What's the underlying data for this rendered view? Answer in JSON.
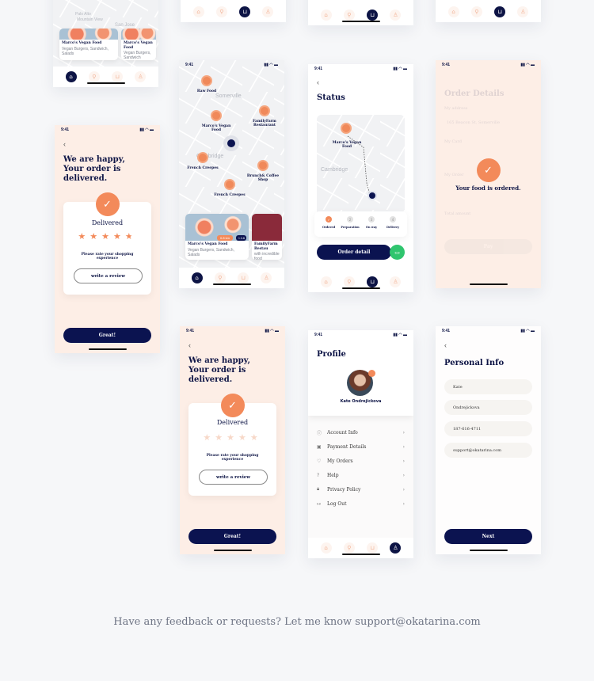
{
  "status_time": "9:41",
  "nav_icons": [
    "home-icon",
    "map-pin-icon",
    "cart-icon",
    "user-icon"
  ],
  "colors": {
    "navy": "#0b1350",
    "accent": "#f38a5a",
    "peach": "#fdeee6",
    "green": "#2fc56e"
  },
  "map_preview": {
    "places": [
      "Palo Alto",
      "Mountain View",
      "San Jose"
    ],
    "cards": [
      {
        "name": "Marco's Vegan Food",
        "sub": "Vegan Burgers, Sandwich, Salads"
      },
      {
        "name": "Marco's Vegan Food",
        "sub": "Vegan Burgers, Sandwich"
      }
    ]
  },
  "map_screen": {
    "areas": [
      "Somerville",
      "Cambridge"
    ],
    "pins": [
      "Raw Food",
      "Marco's Vegan Food",
      "FamilyFarm Restaurant",
      "French Creepes",
      "Brunch& Coffee Shop",
      "French Creepes"
    ],
    "cards": [
      {
        "name": "Marco's Vegan Food",
        "sub": "Vegan Burgers, Sandwich, Salads",
        "distance": "0.8 km",
        "rating": "4.6"
      },
      {
        "name": "FamilyFarm Restau",
        "sub": "with incredible food"
      }
    ]
  },
  "status_screen": {
    "title": "Status",
    "map_area": "Cambridge",
    "pin": "Marco's Vegan Food",
    "steps": [
      {
        "num": "✓",
        "label": "Ordered",
        "done": true
      },
      {
        "num": "2",
        "label": "Preparation"
      },
      {
        "num": "3",
        "label": "On way"
      },
      {
        "num": "4",
        "label": "Delivery"
      }
    ],
    "button": "Order detail"
  },
  "order_details": {
    "title": "Order Details",
    "labels": [
      "My address",
      "My Card",
      "My Order",
      "Total amount"
    ],
    "address": "165 Beacon St, Somerville",
    "pay": "Pay",
    "message": "Your food is ordered."
  },
  "delivered_rated": {
    "heading": "We are happy, Your order is delivered.",
    "status": "Delivered",
    "rating": 4.5,
    "prompt": "Please rate your shopping experience",
    "review": "write a review",
    "button": "Great!"
  },
  "delivered_unrated": {
    "heading": "We are happy, Your order is delivered.",
    "status": "Delivered",
    "rating": 0,
    "prompt": "Please rate your shopping experience",
    "review": "write a review",
    "button": "Great!"
  },
  "profile": {
    "title": "Profile",
    "name": "Kate Ondrejickova",
    "menu": [
      {
        "icon": "info-icon",
        "label": "Account Info"
      },
      {
        "icon": "card-icon",
        "label": "Payment Details"
      },
      {
        "icon": "heart-icon",
        "label": "My Orders"
      },
      {
        "icon": "help-icon",
        "label": "Help"
      },
      {
        "icon": "lock-icon",
        "label": "Privacy Policy"
      },
      {
        "icon": "logout-icon",
        "label": "Log Out"
      }
    ]
  },
  "personal_info": {
    "title": "Personal Info",
    "fields": [
      "Kate",
      "Ondrejickova",
      "187-616-4711",
      "support@okatarina.com"
    ],
    "button": "Next"
  },
  "footer": "Have any feedback or requests? Let me know support@okatarina.com"
}
